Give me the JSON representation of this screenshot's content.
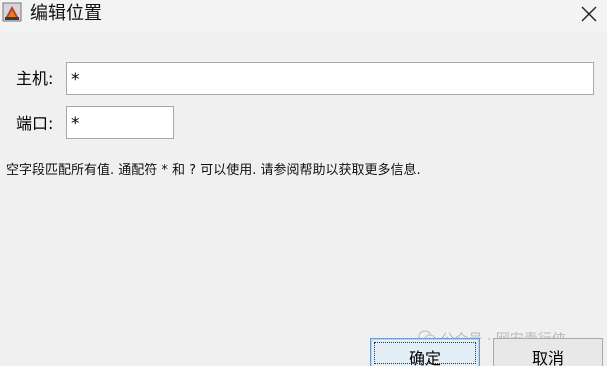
{
  "window": {
    "title": "编辑位置",
    "app_icon": "java-app-icon",
    "close_icon": "close-icon"
  },
  "form": {
    "host": {
      "label": "主机:",
      "value": "*",
      "placeholder": ""
    },
    "port": {
      "label": "端口:",
      "value": "*",
      "placeholder": ""
    },
    "hint": "空字段匹配所有值. 通配符 * 和 ? 可以使用. 请参阅帮助以获取更多信息."
  },
  "buttons": {
    "ok_label": "确定",
    "cancel_label": "取消"
  },
  "watermark": {
    "text": "公众号 · 网安青行侠",
    "icon": "wechat-icon"
  },
  "colors": {
    "background": "#f0f0f0",
    "field_border": "#a8a8a8",
    "default_button_border": "#6a9bd0"
  }
}
